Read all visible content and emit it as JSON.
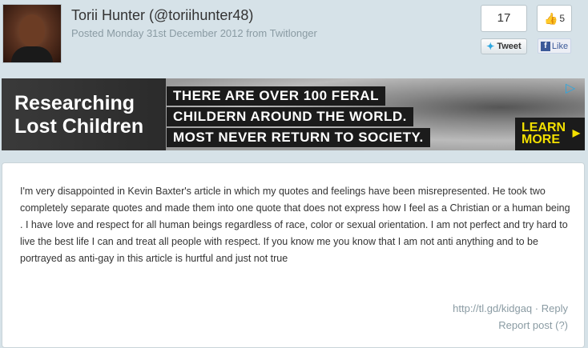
{
  "header": {
    "author": "Torii Hunter (@toriihunter48)",
    "posted": "Posted Monday 31st December 2012 from Twitlonger"
  },
  "share": {
    "tweet_count": "17",
    "tweet_label": "Tweet",
    "like_count": "5",
    "like_label": "Like"
  },
  "ad": {
    "title_line1": "Researching",
    "title_line2": "Lost Children",
    "line1": "THERE ARE OVER 100 FERAL",
    "line2": "CHILDERN AROUND THE WORLD.",
    "line3": "MOST NEVER RETURN TO SOCIETY.",
    "cta_line1": "LEARN",
    "cta_line2": "MORE"
  },
  "post": {
    "text": "I'm very disappointed in Kevin Baxter's article in which my quotes and feelings have been misrepresented. He took two completely separate quotes and made them into one quote that does not express how I feel as a Christian or a human being . I have love and respect for all human beings regardless of race, color or sexual orientation. I am not perfect and try hard to live the best life I can and treat all people with respect. If you know me you know that I am not anti anything and to be portrayed as anti-gay in this article is hurtful and just not true",
    "short_link": "http://tl.gd/kidgaq",
    "separator": "·",
    "reply": "Reply",
    "report": "Report post (?)"
  }
}
